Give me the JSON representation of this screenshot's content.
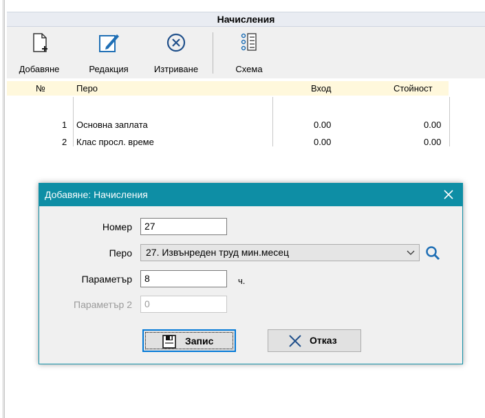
{
  "window": {
    "title": "Начисления"
  },
  "toolbar": {
    "add_label": "Добавяне",
    "edit_label": "Редакция",
    "delete_label": "Изтриване",
    "scheme_label": "Схема"
  },
  "grid": {
    "columns": [
      "№",
      "Перо",
      "Вход",
      "Стойност"
    ],
    "rows": [
      {
        "num": "1",
        "item": "Основна заплата",
        "input": "0.00",
        "value": "0.00"
      },
      {
        "num": "2",
        "item": "Клас просл. време",
        "input": "0.00",
        "value": "0.00"
      }
    ]
  },
  "dialog": {
    "title": "Добавяне: Начисления",
    "number_label": "Номер",
    "number_value": "27",
    "item_label": "Перо",
    "item_value": "27. Извънреден труд мин.месец",
    "param_label": "Параметър",
    "param_value": "8",
    "param_unit": "ч.",
    "param2_label": "Параметър 2",
    "param2_value": "0",
    "save_label": "Запис",
    "cancel_label": "Отказ"
  },
  "colors": {
    "accent": "#0e8ea5",
    "header_bg": "#fff8dc",
    "focus": "#0078d7"
  }
}
